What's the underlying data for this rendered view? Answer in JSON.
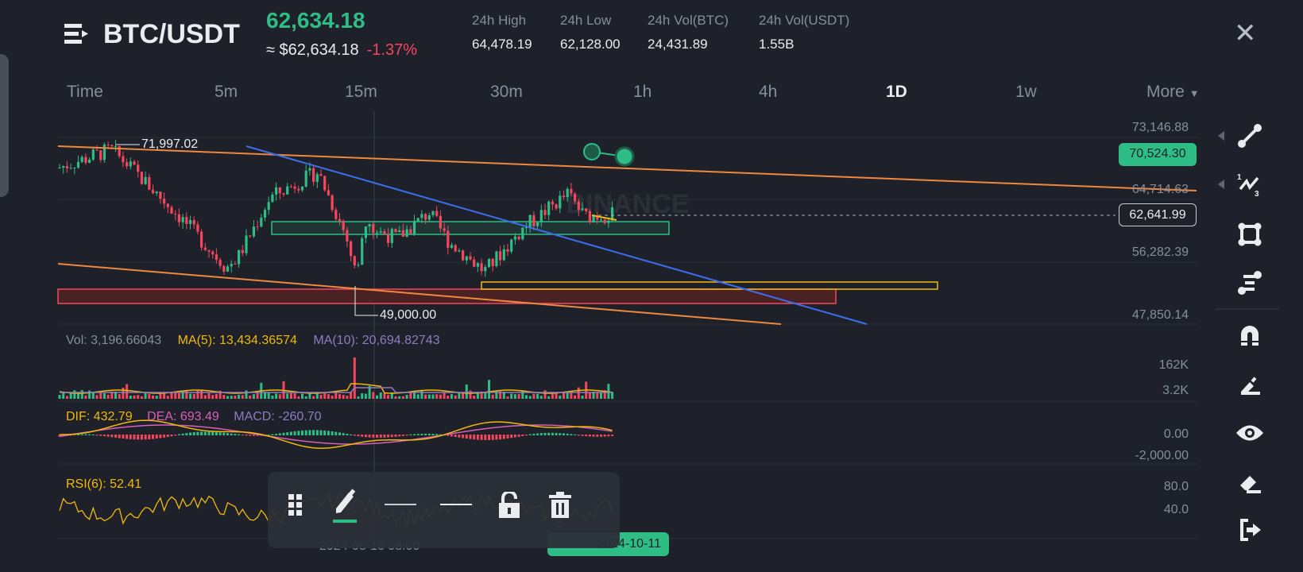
{
  "header": {
    "pair": "BTC/USDT",
    "last_price": "62,634.18",
    "fiat_price": "≈ $62,634.18",
    "change": "-1.37%",
    "stats": [
      {
        "label": "24h High",
        "value": "64,478.19"
      },
      {
        "label": "24h Low",
        "value": "62,128.00"
      },
      {
        "label": "24h Vol(BTC)",
        "value": "24,431.89"
      },
      {
        "label": "24h Vol(USDT)",
        "value": "1.55B"
      }
    ]
  },
  "intervals": [
    "Time",
    "5m",
    "15m",
    "30m",
    "1h",
    "4h",
    "1D",
    "1w",
    "More"
  ],
  "active_interval": "1D",
  "price_axis": [
    "73,146.88",
    "64,714.63",
    "56,282.39",
    "47,850.14"
  ],
  "badges": {
    "alert_price": "70,524.30",
    "current_price": "62,641.99"
  },
  "annotations": {
    "high": "71,997.02",
    "low": "49,000.00"
  },
  "watermark": "BINANCE",
  "volume": {
    "vol": "Vol: 3,196.66043",
    "ma5": "MA(5): 13,434.36574",
    "ma10": "MA(10): 20,694.82743",
    "axis": [
      "162K",
      "3.2K"
    ]
  },
  "macd": {
    "dif": "DIF: 432.79",
    "dea": "DEA: 693.49",
    "macd": "MACD: -260.70",
    "axis": [
      "0.00",
      "-2,000.00"
    ]
  },
  "rsi": {
    "label": "RSI(6): 52.41",
    "axis": [
      "80.0",
      "40.0"
    ]
  },
  "time_axis": {
    "left": "2024-08-16 08:00",
    "right": "2024-10-11"
  },
  "colors": {
    "up": "#2ebd85",
    "down": "#f6465d",
    "bg": "#1e2129",
    "accent": "#f0b90b"
  }
}
